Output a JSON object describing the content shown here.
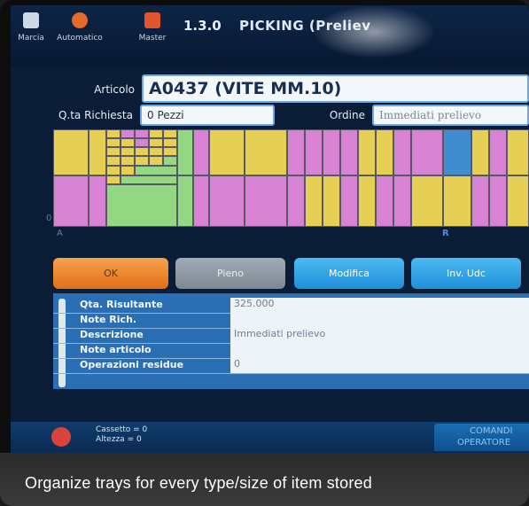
{
  "top": {
    "buttons": [
      {
        "label": "Marcia",
        "icon": "hand-icon"
      },
      {
        "label": "Automatico",
        "icon": "gear-icon"
      },
      {
        "label": "Master",
        "icon": "shield-icon"
      }
    ],
    "version": "1.3.0",
    "title": "PICKING (Preliev"
  },
  "form": {
    "articolo_label": "Articolo",
    "articolo_value": "A0437 (VITE MM.10)",
    "qta_label": "Q.ta Richiesta",
    "qta_value": "0 Pezzi",
    "ordine_label": "Ordine",
    "ordine_value": "Immediati prelievo"
  },
  "grid": {
    "axis_left": "A",
    "axis_marker": "R",
    "row_marker": "0"
  },
  "actions": [
    {
      "label": "OK"
    },
    {
      "label": "Pieno"
    },
    {
      "label": "Modifica"
    },
    {
      "label": "Inv. Udc"
    }
  ],
  "info": [
    {
      "key": "Qta. Risultante",
      "value": "325.000"
    },
    {
      "key": "Note Rich.",
      "value": ""
    },
    {
      "key": "Descrizione",
      "value": "Immediati prelievo"
    },
    {
      "key": "Note articolo",
      "value": ""
    },
    {
      "key": "Operazioni residue",
      "value": "0"
    }
  ],
  "bottom": {
    "cassetto": "Cassetto = 0",
    "altezza": "Altezza = 0",
    "comandi": "COMANDI",
    "operatore": "OPERATORE"
  },
  "caption": "Organize trays for every type/size of item stored",
  "colors": {
    "ok_button": "#e97a1c",
    "pieno_button": "#7f8a95",
    "blue_button": "#2aa3e8",
    "info_bg": "#2a6fb3",
    "tray_yellow": "#e6cf52",
    "tray_pink": "#d882d3",
    "tray_green": "#93d883",
    "tray_blue": "#3f8ccf"
  }
}
